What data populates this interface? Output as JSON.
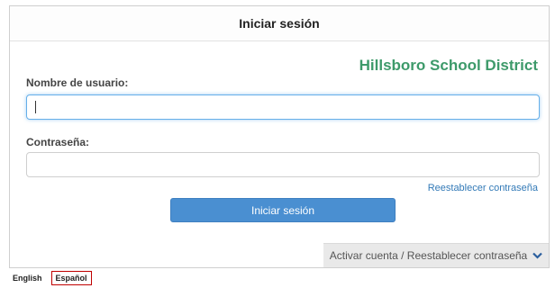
{
  "header": {
    "title": "Iniciar sesión"
  },
  "brand": {
    "district_name": "Hillsboro School District",
    "color": "#3d9a6a"
  },
  "form": {
    "username_label": "Nombre de usuario:",
    "username_value": "",
    "password_label": "Contraseña:",
    "password_value": "",
    "reset_password_link": "Reestablecer contraseña",
    "submit_label": "Iniciar sesión"
  },
  "activate": {
    "label": "Activar cuenta / Reestablecer contraseña",
    "icon": "chevron-down-icon"
  },
  "languages": {
    "items": [
      "English",
      "Español"
    ],
    "selected": "Español"
  },
  "colors": {
    "primary_button": "#4a8fd1",
    "link": "#337ab7",
    "selected_language_border": "#c00000"
  }
}
